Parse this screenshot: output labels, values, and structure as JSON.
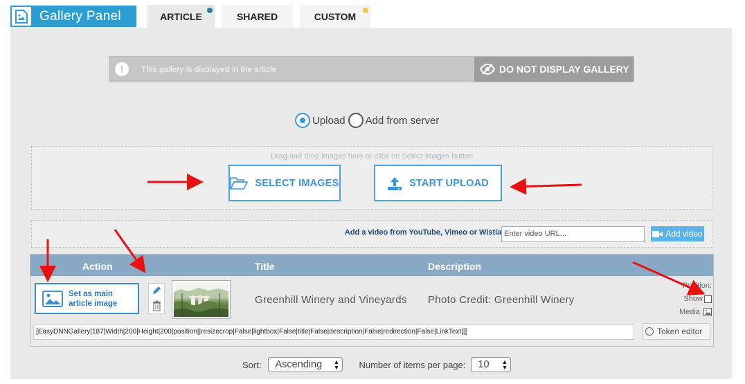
{
  "header": {
    "title": "Gallery Panel",
    "icon": "image-icon"
  },
  "tabs": [
    {
      "label": "ARTICLE",
      "active": true,
      "dot_color": "#2e7fa6"
    },
    {
      "label": "SHARED",
      "active": false
    },
    {
      "label": "CUSTOM",
      "active": false,
      "dot_color": "#e6c94a"
    }
  ],
  "notice": {
    "text": "This gallery is displayed in the article",
    "button_label": "DO NOT DISPLAY GALLERY"
  },
  "source": {
    "options": [
      "Upload",
      "Add from server"
    ],
    "selected": "Upload"
  },
  "upload": {
    "drop_hint": "Drag and drop images here or click on Select images button",
    "select_label": "SELECT IMAGES",
    "start_label": "START UPLOAD"
  },
  "video": {
    "label": "Add a video from YouTube, Vimeo or Wistia:",
    "placeholder": "Enter video URL...",
    "button_label": "Add video"
  },
  "table": {
    "columns": [
      "Action",
      "Title",
      "Description"
    ],
    "rows": [
      {
        "set_main_label": "Set as main article image",
        "title": "Greenhill Winery and Vineyards",
        "description": "Photo Credit: Greenhill Winery",
        "position_label": "Position:",
        "show_label": "Show",
        "media_label": "Media",
        "token": "[EasyDNNGallery|187|Width|200|Height|200|position||resizecrop|False|lightbox|False|title|False|description|False|redirection|False|LinkText||]",
        "token_button": "Token editor"
      }
    ]
  },
  "footer": {
    "sort_label": "Sort:",
    "sort_value": "Ascending",
    "per_page_label": "Number of items per page:",
    "per_page_value": "10"
  },
  "colors": {
    "accent": "#2b9fd3",
    "annotation_arrow": "#e81010"
  }
}
